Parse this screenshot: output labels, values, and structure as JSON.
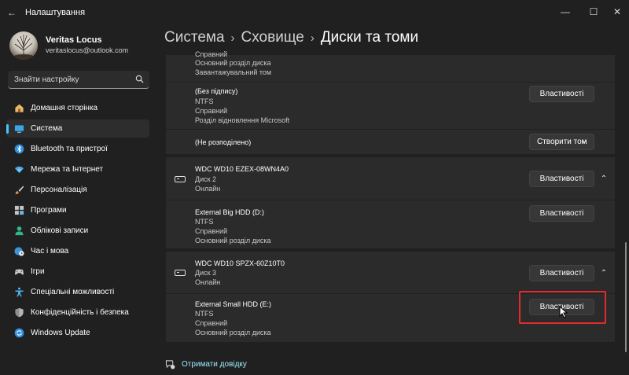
{
  "window": {
    "title": "Налаштування",
    "back_icon": "←",
    "minimize_icon": "—",
    "maximize_icon": "☐",
    "close_icon": "✕"
  },
  "user": {
    "name": "Veritas Locus",
    "email": "veritaslocus@outlook.com"
  },
  "search": {
    "placeholder": "Знайти настройку"
  },
  "nav": {
    "items": [
      {
        "label": "Домашня сторінка",
        "icon": "home-icon"
      },
      {
        "label": "Система",
        "icon": "system-icon",
        "active": true
      },
      {
        "label": "Bluetooth та пристрої",
        "icon": "bluetooth-icon"
      },
      {
        "label": "Мережа та Інтернет",
        "icon": "wifi-icon"
      },
      {
        "label": "Персоналізація",
        "icon": "brush-icon"
      },
      {
        "label": "Програми",
        "icon": "apps-icon"
      },
      {
        "label": "Облікові записи",
        "icon": "account-icon"
      },
      {
        "label": "Час і мова",
        "icon": "globe-clock-icon"
      },
      {
        "label": "Ігри",
        "icon": "gamepad-icon"
      },
      {
        "label": "Спеціальні можливості",
        "icon": "accessibility-icon"
      },
      {
        "label": "Конфіденційність і безпека",
        "icon": "shield-icon"
      },
      {
        "label": "Windows Update",
        "icon": "update-icon"
      }
    ]
  },
  "header": {
    "crumb1": "Система",
    "crumb2": "Сховище",
    "current": "Диски та томи",
    "separator": "›"
  },
  "volumes_top": {
    "partial_line1": "Справний",
    "partial_line2": "Основний розділ диска",
    "partial_line3": "Завантажувальний том",
    "recovery": {
      "title": "(Без підпису)",
      "fs": "NTFS",
      "status": "Справний",
      "type": "Розділ відновлення Microsoft",
      "button": "Властивості"
    },
    "unallocated": {
      "title": "(Не розподілено)",
      "button": "Створити том",
      "chevron": "⌄"
    }
  },
  "disk2": {
    "name": "WDC WD10 EZEX-08WN4A0",
    "number": "Диск 2",
    "state": "Онлайн",
    "button": "Властивості",
    "chevron": "⌃",
    "volume": {
      "title": "External Big HDD (D:)",
      "fs": "NTFS",
      "status": "Справний",
      "type": "Основний розділ диска",
      "button": "Властивості"
    }
  },
  "disk3": {
    "name": "WDC WD10 SPZX-60Z10T0",
    "number": "Диск 3",
    "state": "Онлайн",
    "button": "Властивості",
    "chevron": "⌃",
    "volume": {
      "title": "External Small HDD (E:)",
      "fs": "NTFS",
      "status": "Справний",
      "type": "Основний розділ диска",
      "button": "Властивості"
    }
  },
  "footer": {
    "help": "Отримати довідку"
  },
  "colors": {
    "background": "#202020",
    "panel": "#2b2b2b",
    "accent": "#4cc2ff",
    "highlight": "#e32b2b",
    "link": "#99ebff"
  }
}
